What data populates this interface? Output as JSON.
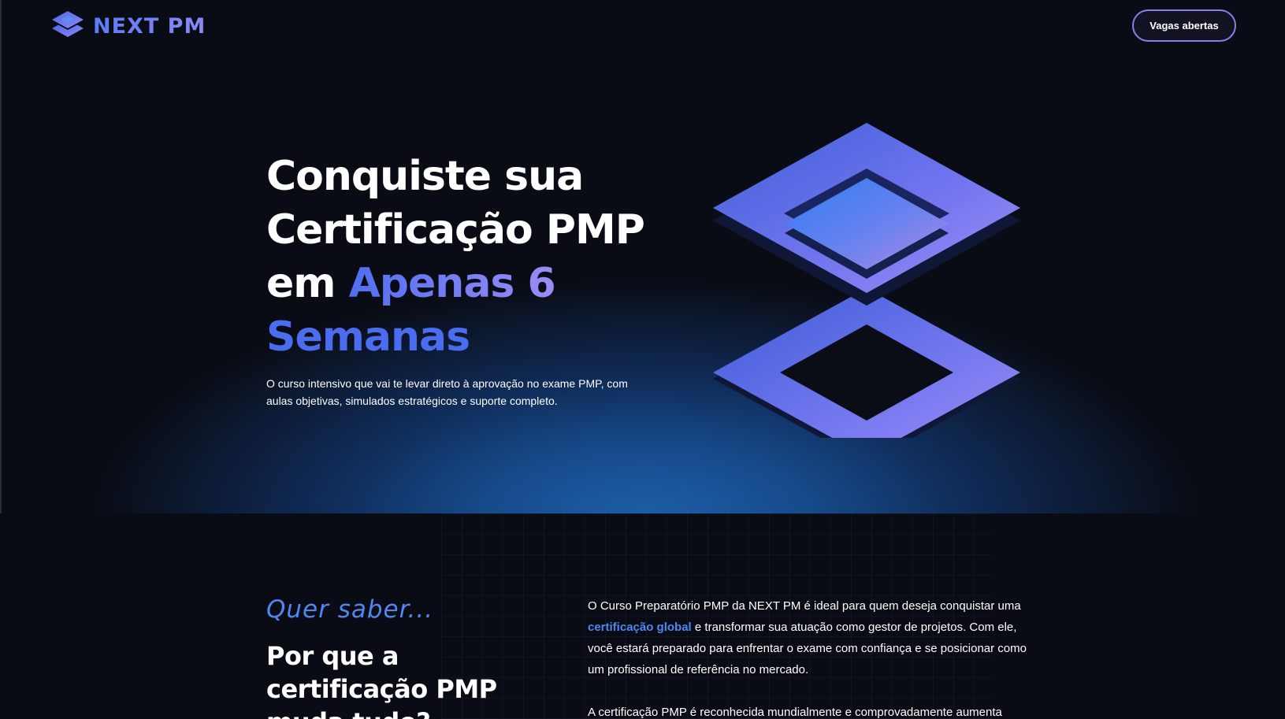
{
  "brand": {
    "name": "NEXT PM",
    "logo_icon": "layers-icon"
  },
  "nav": {
    "cta_label": "Vagas abertas"
  },
  "hero": {
    "title_line1": "Conquiste sua",
    "title_line2": "Certificação PMP",
    "title_em": "em",
    "title_accent": "Apenas 6",
    "title_accent2": "Semanas",
    "subtitle": "O curso intensivo que vai te levar direto à aprovação no exame PMP, com aulas objetivas, simulados estratégicos e suporte completo.",
    "illustration": "stacked-layers-icon"
  },
  "about": {
    "kicker": "Quer saber...",
    "title": "Por que a certificação PMP muda tudo?",
    "paragraph1_before": "O Curso Preparatório PMP da NEXT PM é ideal para quem deseja conquistar uma",
    "paragraph1_link": "certificação global",
    "paragraph1_after": "e transformar sua atuação como gestor de projetos. Com ele, você estará preparado para enfrentar o exame com confiança e se posicionar como um profissional de referência no mercado.",
    "paragraph2": "A certificação PMP é reconhecida mundialmente e comprovadamente aumenta"
  },
  "colors": {
    "background": "#0a0c15",
    "accent_blue": "#4f86f0",
    "accent_purple": "#8b7cf0"
  }
}
